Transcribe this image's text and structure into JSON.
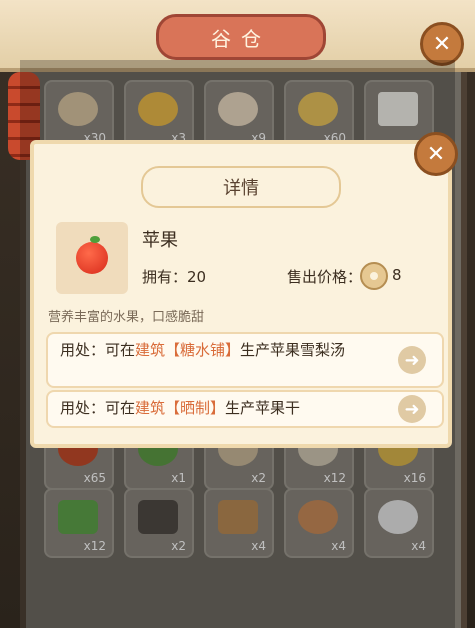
{
  "header": {
    "title": "谷仓"
  },
  "colors": {
    "accent": "#d97458",
    "highlight": "#d96c3a",
    "modal_bg": "#fbf2dd"
  },
  "grid": {
    "row1": [
      {
        "count": "x30"
      },
      {
        "count": "x3"
      },
      {
        "count": "x9"
      },
      {
        "count": "x60"
      },
      {
        "count": ""
      }
    ],
    "row4": [
      {
        "count": "x65"
      },
      {
        "count": "x1"
      },
      {
        "count": "x2"
      },
      {
        "count": "x12"
      },
      {
        "count": "x16"
      }
    ],
    "row5": [
      {
        "count": "x12"
      },
      {
        "count": "x2"
      },
      {
        "count": "x4"
      },
      {
        "count": "x4"
      },
      {
        "count": "x4"
      }
    ]
  },
  "detail": {
    "title": "详情",
    "item_name": "苹果",
    "own_label": "拥有：",
    "own_value": "20",
    "price_label": "售出价格：",
    "price_value": "8",
    "description": "营养丰富的水果，口感脆甜",
    "uses": [
      {
        "prefix": "用处：可在",
        "link": "建筑【糖水铺】",
        "suffix": "生产苹果雪梨汤"
      },
      {
        "prefix": "用处：可在",
        "link": "建筑【晒制】",
        "suffix": "生产苹果干"
      }
    ]
  },
  "icons": {
    "close": "close-icon",
    "arrow": "arrow-right-icon",
    "coin": "coin-icon"
  }
}
